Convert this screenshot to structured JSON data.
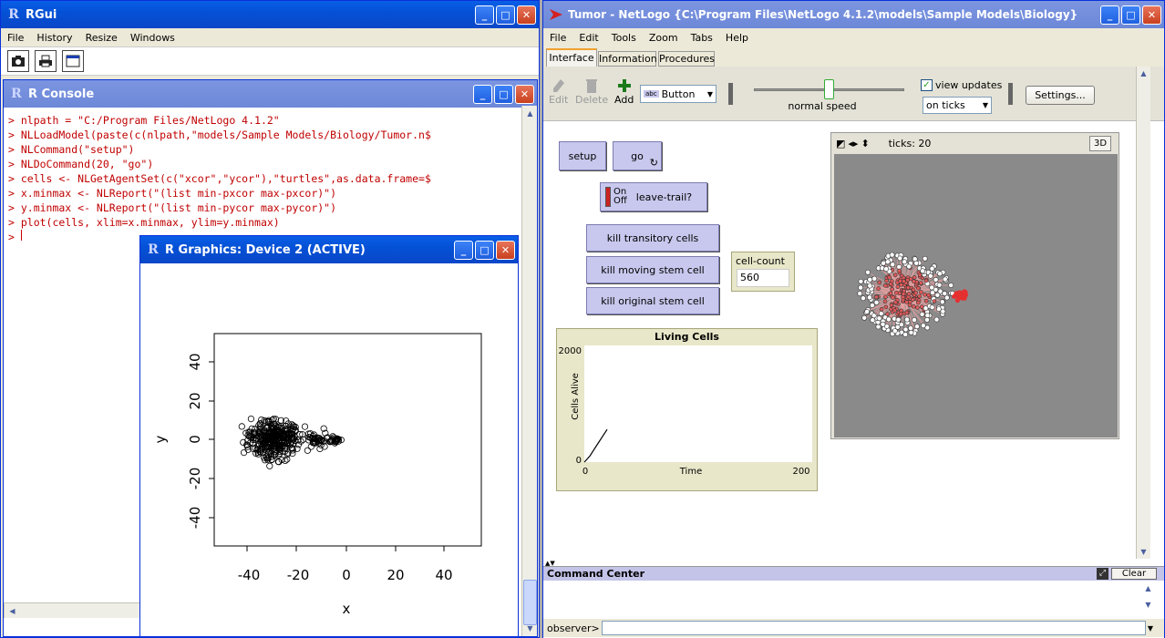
{
  "rgui": {
    "title": "RGui",
    "menu": [
      "File",
      "History",
      "Resize",
      "Windows"
    ],
    "console": {
      "title": "R Console",
      "lines": [
        "> nlpath = \"C:/Program Files/NetLogo 4.1.2\"",
        "> NLLoadModel(paste(c(nlpath,\"models/Sample Models/Biology/Tumor.n$",
        "> NLCommand(\"setup\")",
        "> NLDoCommand(20, \"go\")",
        "> cells <- NLGetAgentSet(c(\"xcor\",\"ycor\"),\"turtles\",as.data.frame=$",
        "> x.minmax <- NLReport(\"(list min-pxcor max-pxcor)\")",
        "> y.minmax <- NLReport(\"(list min-pycor max-pycor)\")",
        "> plot(cells, xlim=x.minmax, ylim=y.minmax)",
        "> "
      ]
    },
    "graphics": {
      "title": "R Graphics: Device 2 (ACTIVE)",
      "xlabel": "x",
      "ylabel": "y",
      "xticks": [
        "-40",
        "-20",
        "0",
        "20",
        "40"
      ],
      "yticks": [
        "40",
        "20",
        "0",
        "-20",
        "-40"
      ]
    }
  },
  "chart_data": {
    "type": "scatter",
    "xlabel": "x",
    "ylabel": "y",
    "xlim": [
      -50,
      50
    ],
    "ylim": [
      -50,
      50
    ],
    "clusters": [
      {
        "center": [
          -30,
          0
        ],
        "spread": [
          10,
          9
        ],
        "n": 330
      },
      {
        "center": [
          -12,
          0
        ],
        "spread": [
          4,
          4
        ],
        "n": 40
      },
      {
        "center": [
          -5,
          0
        ],
        "spread": [
          2,
          2
        ],
        "n": 25
      }
    ]
  },
  "netlogo": {
    "title": "Tumor - NetLogo {C:\\Program Files\\NetLogo 4.1.2\\models\\Sample Models\\Biology}",
    "menu": [
      "File",
      "Edit",
      "Tools",
      "Zoom",
      "Tabs",
      "Help"
    ],
    "tabs": [
      "Interface",
      "Information",
      "Procedures"
    ],
    "toolbar": {
      "edit": "Edit",
      "delete": "Delete",
      "add": "Add",
      "widget_type": "Button",
      "speed": "normal speed",
      "speed_level": 0.5,
      "view_updates": "view updates",
      "update_mode": "on ticks",
      "settings": "Settings..."
    },
    "buttons": {
      "setup": "setup",
      "go": "go",
      "kill_transitory": "kill transitory cells",
      "kill_moving": "kill moving stem cell",
      "kill_original": "kill original stem cell"
    },
    "switch": {
      "on": "On",
      "off": "Off",
      "label": "leave-trail?"
    },
    "monitor": {
      "label": "cell-count",
      "value": "560"
    },
    "plot": {
      "title": "Living Cells",
      "ylabel": "Cells Alive",
      "xlabel": "Time",
      "ymax": "2000",
      "ymin": "0",
      "xmin": "0",
      "xmax": "200"
    },
    "plot_data": {
      "x": [
        0,
        2,
        5,
        8,
        12,
        16,
        20
      ],
      "y": [
        0,
        40,
        110,
        200,
        320,
        440,
        560
      ],
      "xlim": [
        0,
        200
      ],
      "ylim": [
        0,
        2000
      ]
    },
    "view": {
      "ticks": "ticks: 20",
      "btn3d": "3D"
    },
    "command_center": {
      "title": "Command Center",
      "clear": "Clear",
      "observer": "observer>"
    }
  }
}
